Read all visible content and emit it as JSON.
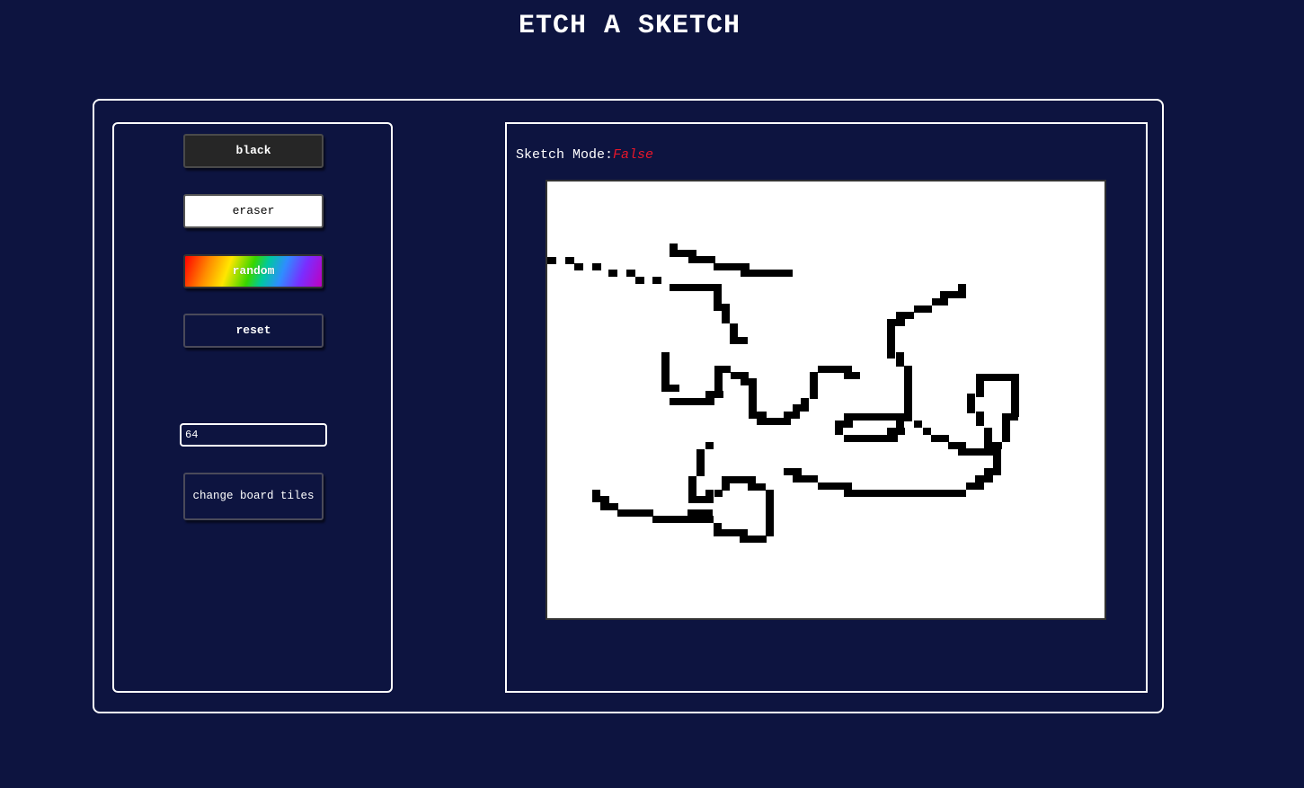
{
  "page": {
    "title": "ETCH A SKETCH"
  },
  "controls": {
    "black_label": "black",
    "eraser_label": "eraser",
    "random_label": "random",
    "reset_label": "reset",
    "tiles_input_value": "64",
    "change_tiles_label": "change board tiles"
  },
  "board": {
    "sketch_mode_label": "Sketch Mode:",
    "sketch_mode_value": "False",
    "grid_size": 64,
    "background_color": "#ffffff",
    "ink_color": "#000000"
  },
  "colors": {
    "page_background": "#0d1440",
    "border": "#ffffff",
    "sketch_mode_false": "#e8162a"
  }
}
